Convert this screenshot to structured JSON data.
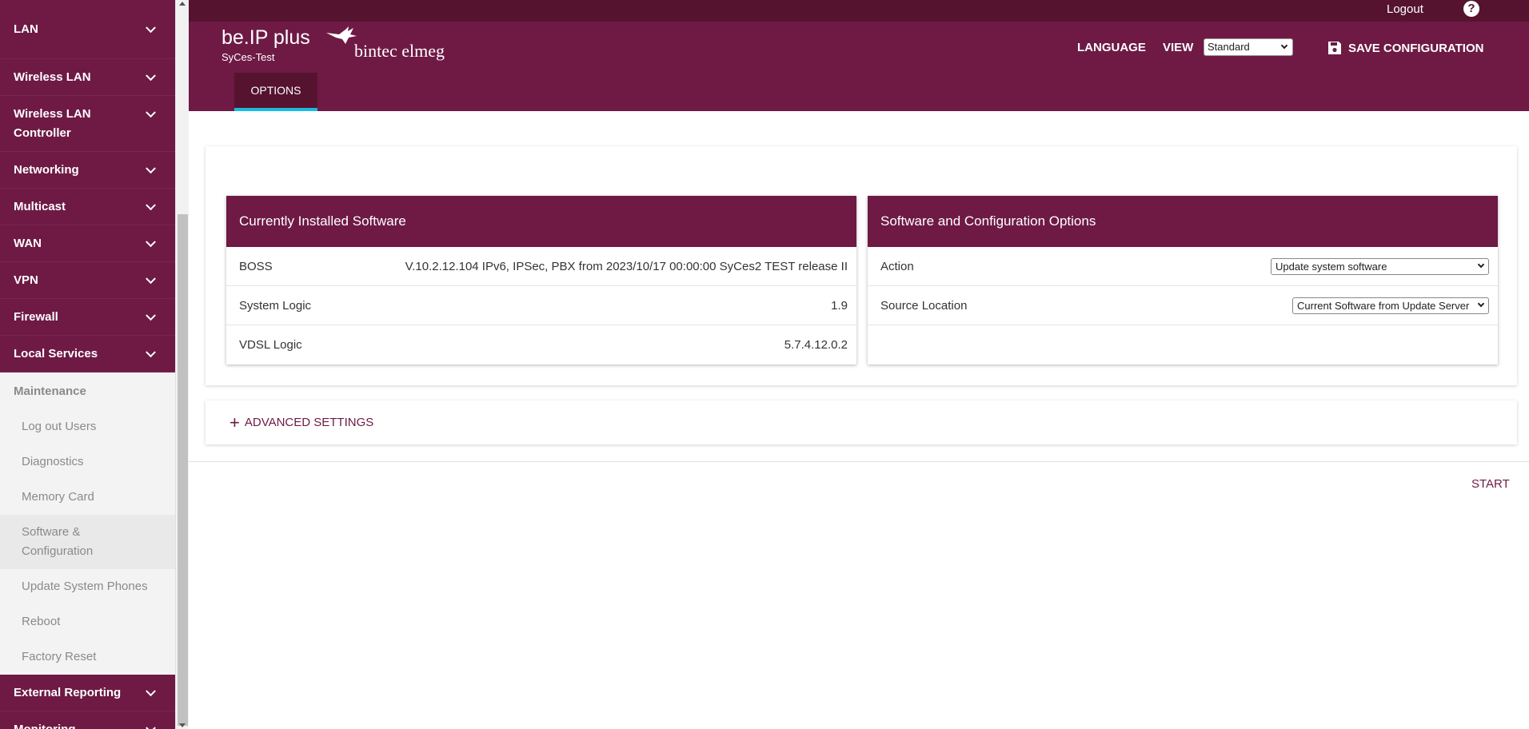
{
  "sidebar": {
    "top_items": [
      {
        "label": "LAN"
      },
      {
        "label": "Wireless LAN"
      },
      {
        "label": "Wireless LAN Controller"
      },
      {
        "label": "Networking"
      },
      {
        "label": "Multicast"
      },
      {
        "label": "WAN"
      },
      {
        "label": "VPN"
      },
      {
        "label": "Firewall"
      },
      {
        "label": "Local Services"
      }
    ],
    "maintenance": {
      "label": "Maintenance",
      "items": [
        {
          "label": "Log out Users"
        },
        {
          "label": "Diagnostics"
        },
        {
          "label": "Memory Card"
        },
        {
          "label": "Software & Configuration"
        },
        {
          "label": "Update System Phones"
        },
        {
          "label": "Reboot"
        },
        {
          "label": "Factory Reset"
        }
      ],
      "active_item": "Software & Configuration"
    },
    "bottom_items": [
      {
        "label": "External Reporting"
      },
      {
        "label": "Monitoring"
      }
    ]
  },
  "topbar": {
    "logout": "Logout",
    "help": "?"
  },
  "header": {
    "product": "be.IP plus",
    "hostname": "SyCes-Test",
    "brand": "bintec elmeg",
    "language": "LANGUAGE",
    "view_label": "VIEW",
    "view_value": "Standard",
    "save": "SAVE CONFIGURATION",
    "tab": "OPTIONS"
  },
  "installed": {
    "title": "Currently Installed Software",
    "rows": [
      {
        "label": "BOSS",
        "value": "V.10.2.12.104 IPv6, IPSec, PBX from 2023/10/17 00:00:00 SyCes2 TEST release II"
      },
      {
        "label": "System Logic",
        "value": "1.9"
      },
      {
        "label": "VDSL Logic",
        "value": "5.7.4.12.0.2"
      }
    ]
  },
  "options": {
    "title": "Software and Configuration Options",
    "action_label": "Action",
    "action_value": "Update system software",
    "source_label": "Source Location",
    "source_value": "Current Software from Update Server"
  },
  "advanced": "ADVANCED SETTINGS",
  "start": "START",
  "colors": {
    "brand": "#6e1a45",
    "brand_dark": "#55132f",
    "tab_accent": "#1bbadf"
  }
}
